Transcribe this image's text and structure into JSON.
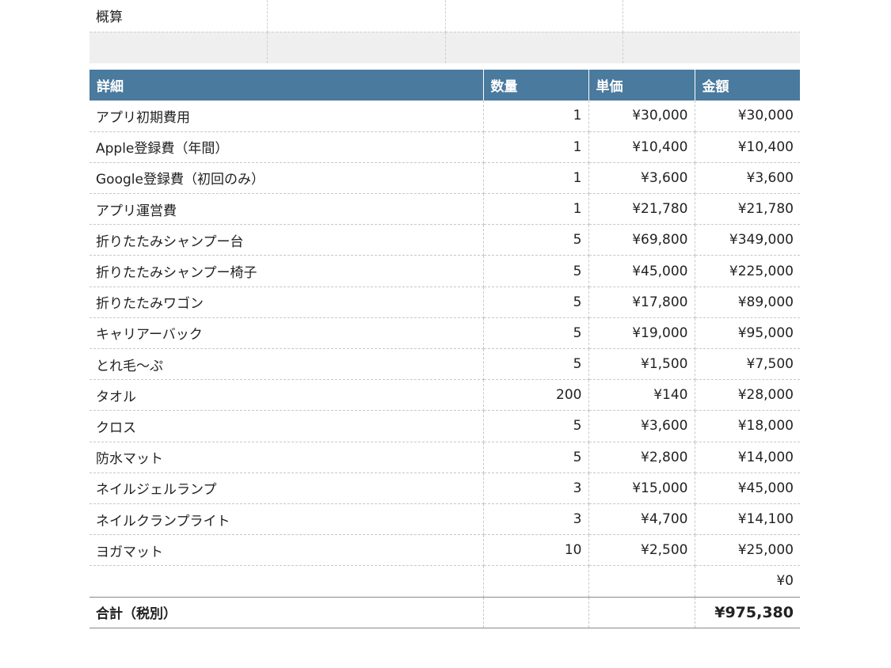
{
  "summary": {
    "label": "概算"
  },
  "table": {
    "headers": {
      "detail": "詳細",
      "qty": "数量",
      "unit_price": "単価",
      "amount": "金額"
    },
    "rows": [
      {
        "name": "アプリ初期費用",
        "qty": "1",
        "price": "¥30,000",
        "amount": "¥30,000"
      },
      {
        "name": "Apple登録費（年間）",
        "qty": "1",
        "price": "¥10,400",
        "amount": "¥10,400"
      },
      {
        "name": "Google登録費（初回のみ）",
        "qty": "1",
        "price": "¥3,600",
        "amount": "¥3,600"
      },
      {
        "name": "アプリ運営費",
        "qty": "1",
        "price": "¥21,780",
        "amount": "¥21,780"
      },
      {
        "name": "折りたたみシャンプー台",
        "qty": "5",
        "price": "¥69,800",
        "amount": "¥349,000"
      },
      {
        "name": "折りたたみシャンプー椅子",
        "qty": "5",
        "price": "¥45,000",
        "amount": "¥225,000"
      },
      {
        "name": "折りたたみワゴン",
        "qty": "5",
        "price": "¥17,800",
        "amount": "¥89,000"
      },
      {
        "name": "キャリアーバック",
        "qty": "5",
        "price": "¥19,000",
        "amount": "¥95,000"
      },
      {
        "name": "とれ毛〜ぷ",
        "qty": "5",
        "price": "¥1,500",
        "amount": "¥7,500"
      },
      {
        "name": "タオル",
        "qty": "200",
        "price": "¥140",
        "amount": "¥28,000"
      },
      {
        "name": "クロス",
        "qty": "5",
        "price": "¥3,600",
        "amount": "¥18,000"
      },
      {
        "name": "防水マット",
        "qty": "5",
        "price": "¥2,800",
        "amount": "¥14,000"
      },
      {
        "name": "ネイルジェルランプ",
        "qty": "3",
        "price": "¥15,000",
        "amount": "¥45,000"
      },
      {
        "name": "ネイルクランプライト",
        "qty": "3",
        "price": "¥4,700",
        "amount": "¥14,100"
      },
      {
        "name": "ヨガマット",
        "qty": "10",
        "price": "¥2,500",
        "amount": "¥25,000"
      },
      {
        "name": "",
        "qty": "",
        "price": "",
        "amount": "¥0"
      }
    ],
    "total": {
      "label": "合計（税別）",
      "amount": "¥975,380"
    }
  }
}
